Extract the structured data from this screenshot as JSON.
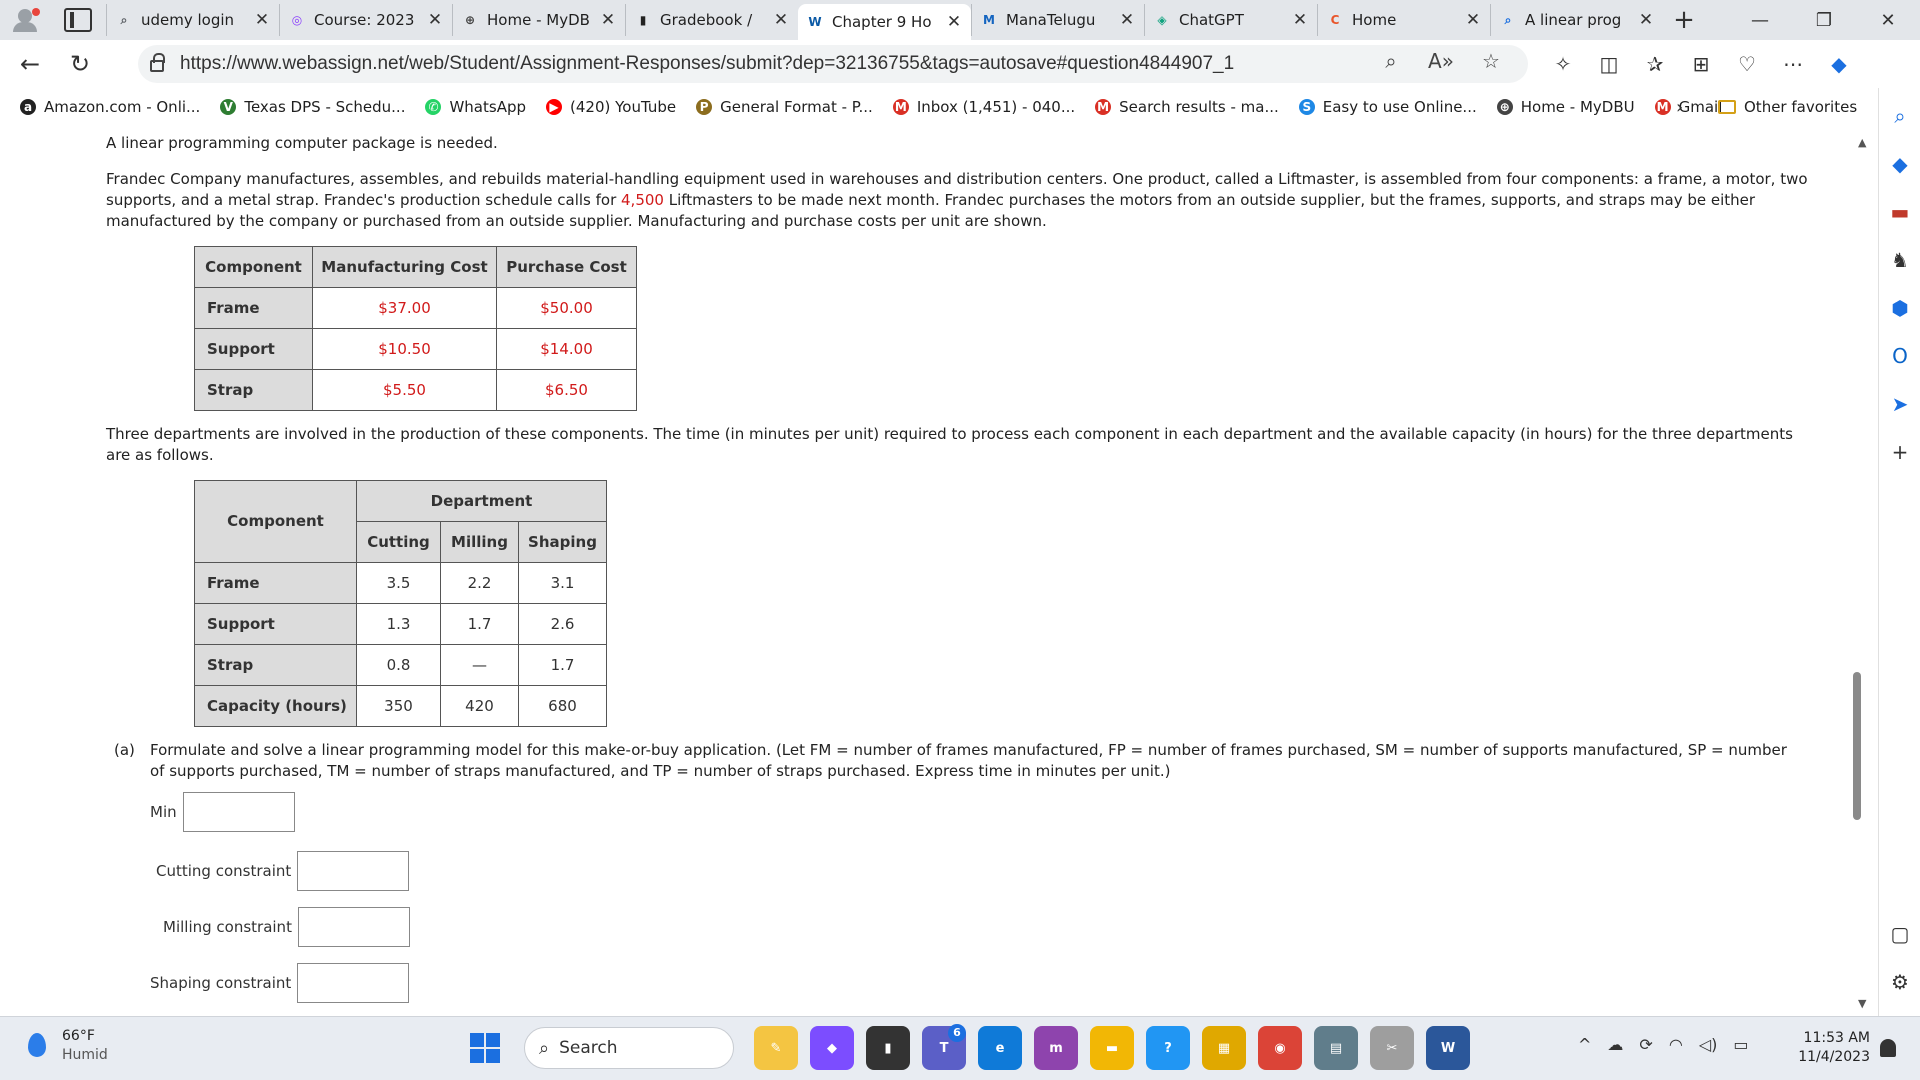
{
  "browser": {
    "tabs": [
      {
        "label": "udemy login",
        "icon": "search-icon",
        "color": "#5f6368",
        "glyph": "⌕"
      },
      {
        "label": "Course: 2023",
        "icon": "course-icon",
        "color": "#8a3ffc",
        "glyph": "◎"
      },
      {
        "label": "Home - MyDB",
        "icon": "university-icon",
        "color": "#444444",
        "glyph": "⊕"
      },
      {
        "label": "Gradebook /",
        "icon": "gradebook-icon",
        "color": "#222222",
        "glyph": "▮"
      },
      {
        "label": "Chapter 9 Ho",
        "icon": "webassign-icon",
        "color": "#0c5aa6",
        "glyph": "W",
        "active": true
      },
      {
        "label": "ManaTelugu",
        "icon": "manatelugu-icon",
        "color": "#1565c0",
        "glyph": "M"
      },
      {
        "label": "ChatGPT",
        "icon": "chatgpt-icon",
        "color": "#10a37f",
        "glyph": "◈"
      },
      {
        "label": "Home",
        "icon": "home-c-icon",
        "color": "#e8552b",
        "glyph": "C"
      },
      {
        "label": "A linear prog",
        "icon": "search-icon",
        "color": "#1b6fe0",
        "glyph": "⌕"
      }
    ],
    "url": "https://www.webassign.net/web/Student/Assignment-Responses/submit?dep=32136755&tags=autosave#question4844907_1",
    "favorites": [
      {
        "label": "Amazon.com - Onli...",
        "icon": "amazon-icon",
        "color": "#222222",
        "glyph": "a"
      },
      {
        "label": "Texas DPS - Schedu...",
        "icon": "texas-dps-icon",
        "color": "#2e7d32",
        "glyph": "V"
      },
      {
        "label": "WhatsApp",
        "icon": "whatsapp-icon",
        "color": "#25d366",
        "glyph": "✆"
      },
      {
        "label": "(420) YouTube",
        "icon": "youtube-icon",
        "color": "#ff0000",
        "glyph": "▶"
      },
      {
        "label": "General Format - P...",
        "icon": "purdue-icon",
        "color": "#8c6d1f",
        "glyph": "P"
      },
      {
        "label": "Inbox (1,451) - 040...",
        "icon": "gmail-icon",
        "color": "#d93025",
        "glyph": "M"
      },
      {
        "label": "Search results - ma...",
        "icon": "gmail-icon",
        "color": "#d93025",
        "glyph": "M"
      },
      {
        "label": "Easy to use Online...",
        "icon": "easy-online-icon",
        "color": "#1e88e5",
        "glyph": "S"
      },
      {
        "label": "Home - MyDBU",
        "icon": "university-icon",
        "color": "#444444",
        "glyph": "⊕"
      },
      {
        "label": "Gmail",
        "icon": "gmail-icon",
        "color": "#d93025",
        "glyph": "M"
      }
    ],
    "other_favorites": "Other favorites"
  },
  "problem": {
    "intro": "A linear programming computer package is needed.",
    "p1_a": "Frandec Company manufactures, assembles, and rebuilds material-handling equipment used in warehouses and distribution centers. One product, called a Liftmaster, is assembled from four components: a frame, a motor, two supports, and a metal strap. Frandec's production schedule calls for ",
    "p1_qty": "4,500",
    "p1_b": " Liftmasters to be made next month. Frandec purchases the motors from an outside supplier, but the frames, supports, and straps may be either manufactured by the company or purchased from an outside supplier. Manufacturing and purchase costs per unit are shown.",
    "cost_table": {
      "headers": [
        "Component",
        "Manufacturing Cost",
        "Purchase Cost"
      ],
      "rows": [
        {
          "name": "Frame",
          "mfg": "$37.00",
          "purchase": "$50.00"
        },
        {
          "name": "Support",
          "mfg": "$10.50",
          "purchase": "$14.00"
        },
        {
          "name": "Strap",
          "mfg": "$5.50",
          "purchase": "$6.50"
        }
      ]
    },
    "p2": "Three departments are involved in the production of these components. The time (in minutes per unit) required to process each component in each department and the available capacity (in hours) for the three departments are as follows.",
    "dept_table": {
      "component_header": "Component",
      "department_header": "Department",
      "departments": [
        "Cutting",
        "Milling",
        "Shaping"
      ],
      "rows": [
        {
          "name": "Frame",
          "values": [
            "3.5",
            "2.2",
            "3.1"
          ]
        },
        {
          "name": "Support",
          "values": [
            "1.3",
            "1.7",
            "2.6"
          ]
        },
        {
          "name": "Strap",
          "values": [
            "0.8",
            "—",
            "1.7"
          ]
        },
        {
          "name": "Capacity (hours)",
          "values": [
            "350",
            "420",
            "680"
          ]
        }
      ]
    },
    "part_a_letter": "(a)",
    "part_a_text": "Formulate and solve a linear programming model for this make-or-buy application. (Let FM = number of frames manufactured, FP = number of frames purchased, SM = number of supports manufactured, SP = number of supports purchased, TM = number of straps manufactured, and TP = number of straps purchased. Express time in minutes per unit.)",
    "fields": {
      "min_label": "Min",
      "cutting_label": "Cutting constraint",
      "milling_label": "Milling constraint",
      "shaping_label": "Shaping constraint"
    }
  },
  "taskbar": {
    "temperature": "66°F",
    "condition": "Humid",
    "search": "Search",
    "teams_badge": "6",
    "time": "11:53 AM",
    "date": "11/4/2023"
  }
}
